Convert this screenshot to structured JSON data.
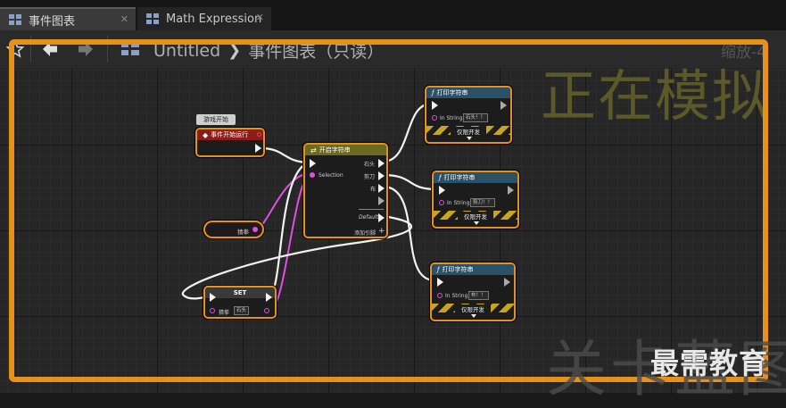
{
  "tabs": [
    {
      "label": "事件图表",
      "icon": "graph-icon",
      "active": true
    },
    {
      "label": "Math Expression",
      "icon": "graph-icon",
      "active": false
    }
  ],
  "breadcrumb": {
    "root": "Untitled",
    "current": "事件图表（只读）"
  },
  "zoom_label": "缩放-4",
  "simulating_label": "正在模拟",
  "watermark": {
    "background_text": "关卡蓝图",
    "foreground_text": "最需教育"
  },
  "colors": {
    "selection_border": "#e7901a",
    "string_pin": "#e24ee0",
    "exec_pin": "#f2f2f2"
  },
  "nodes": {
    "comment": {
      "label": "游戏开始"
    },
    "begin_play": {
      "title": "事件开始运行"
    },
    "switch_string": {
      "title": "开启字符串",
      "selection_label": "Selection",
      "outputs": [
        "石头",
        "剪刀",
        "布"
      ],
      "default_label": "Default",
      "add_pin_label": "添加引脚"
    },
    "variable_get": {
      "label": "猜拳"
    },
    "set_node": {
      "title": "SET",
      "pin_label": "猜拳",
      "value": "石头"
    },
    "print1": {
      "title": "打印字符串",
      "pin_label": "In String",
      "value": "石头！！",
      "dev_only": "仅限开发"
    },
    "print2": {
      "title": "打印字符串",
      "pin_label": "In String",
      "value": "剪刀！！",
      "dev_only": "仅限开发"
    },
    "print3": {
      "title": "打印字符串",
      "pin_label": "In String",
      "value": "布！！",
      "dev_only": "仅限开发"
    }
  }
}
